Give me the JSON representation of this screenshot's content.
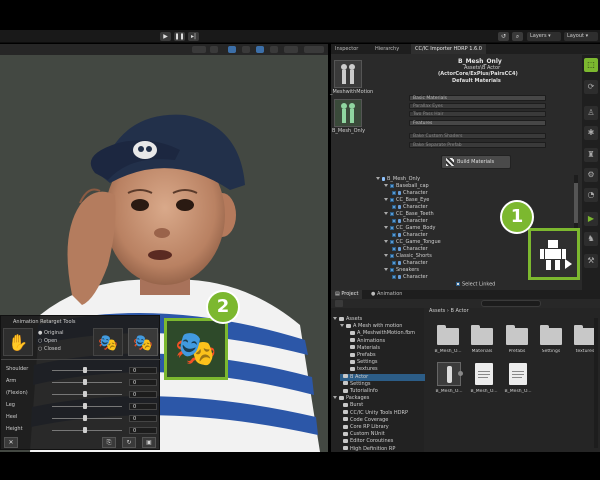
{
  "toolbar": {
    "play_icon": "play-icon",
    "pause_icon": "pause-icon",
    "step_icon": "step-icon",
    "layers_label": "Layers",
    "layout_label": "Layout"
  },
  "inspector": {
    "tabs": [
      "Inspector",
      "Hierarchy",
      "CC/IC Importer HDRP 1.6.0"
    ],
    "thumb1_label": "_MeshwithMotion",
    "thumb2_label": "B_Mesh_Only",
    "header_name": "B_Mesh_Only",
    "header_path": "Assets\\B Actor",
    "header_source": "(ActorCore/ExPlus/PairsCC4)",
    "header_materials": "Default Materials",
    "fields": [
      "Basic Materials",
      "Parallax Eyes",
      "Two Pass Hair",
      "Features"
    ],
    "fields_dim": [
      "Bake Custom Shaders",
      "Bake Separate Prefab"
    ],
    "build_button": "Build Materials",
    "tree": [
      {
        "label": "B_Mesh_Only",
        "indent": 0,
        "kind": "root"
      },
      {
        "label": "Baseball_cap",
        "indent": 1,
        "kind": "node"
      },
      {
        "label": "Character",
        "indent": 2,
        "kind": "leaf"
      },
      {
        "label": "CC_Base_Eye",
        "indent": 1,
        "kind": "node"
      },
      {
        "label": "Character",
        "indent": 2,
        "kind": "leaf"
      },
      {
        "label": "CC_Base_Teeth",
        "indent": 1,
        "kind": "node"
      },
      {
        "label": "Character",
        "indent": 2,
        "kind": "leaf"
      },
      {
        "label": "CC_Game_Body",
        "indent": 1,
        "kind": "node"
      },
      {
        "label": "Character",
        "indent": 2,
        "kind": "leaf"
      },
      {
        "label": "CC_Game_Tongue",
        "indent": 1,
        "kind": "node"
      },
      {
        "label": "Character",
        "indent": 2,
        "kind": "leaf"
      },
      {
        "label": "Classic_Shorts",
        "indent": 1,
        "kind": "node"
      },
      {
        "label": "Character",
        "indent": 2,
        "kind": "leaf"
      },
      {
        "label": "Sneakers",
        "indent": 1,
        "kind": "node"
      },
      {
        "label": "Character",
        "indent": 2,
        "kind": "leaf"
      }
    ],
    "select_linked": "Select Linked"
  },
  "callouts": {
    "one": "1",
    "two": "2"
  },
  "project": {
    "tabs": [
      "Project",
      "Animation"
    ],
    "breadcrumb_root": "Assets",
    "breadcrumb_leaf": "B Actor",
    "tree": [
      {
        "label": "Assets",
        "indent": 0,
        "kind": "open"
      },
      {
        "label": "A Mesh with motion",
        "indent": 1,
        "kind": "open"
      },
      {
        "label": "A_MeshwithMotion.fbm",
        "indent": 2,
        "kind": "folder"
      },
      {
        "label": "Animations",
        "indent": 2,
        "kind": "folder"
      },
      {
        "label": "Materials",
        "indent": 2,
        "kind": "folder"
      },
      {
        "label": "Prefabs",
        "indent": 2,
        "kind": "folder"
      },
      {
        "label": "Settings",
        "indent": 2,
        "kind": "folder"
      },
      {
        "label": "textures",
        "indent": 2,
        "kind": "folder"
      },
      {
        "label": "B Actor",
        "indent": 1,
        "kind": "selected"
      },
      {
        "label": "Settings",
        "indent": 1,
        "kind": "folder"
      },
      {
        "label": "TutorialInfo",
        "indent": 1,
        "kind": "folder"
      },
      {
        "label": "Packages",
        "indent": 0,
        "kind": "open"
      },
      {
        "label": "Burst",
        "indent": 1,
        "kind": "folder"
      },
      {
        "label": "CC/IC Unity Tools HDRP",
        "indent": 1,
        "kind": "folder"
      },
      {
        "label": "Code Coverage",
        "indent": 1,
        "kind": "folder"
      },
      {
        "label": "Core RP Library",
        "indent": 1,
        "kind": "folder"
      },
      {
        "label": "Custom NUnit",
        "indent": 1,
        "kind": "folder"
      },
      {
        "label": "Editor Coroutines",
        "indent": 1,
        "kind": "folder"
      },
      {
        "label": "High Definition RP",
        "indent": 1,
        "kind": "folder"
      }
    ],
    "folders": [
      "B_Mesh_O...",
      "Materials",
      "Prefabs",
      "Settings",
      "textures"
    ],
    "files": [
      "B_Mesh_O...",
      "B_Mesh_O...",
      "B_Mesh_O..."
    ]
  },
  "retarget": {
    "title": "Animation Retarget Tools",
    "radio": [
      "Original",
      "Open",
      "Closed"
    ],
    "sliders": [
      {
        "label": "Shoulder",
        "value": "0"
      },
      {
        "label": "Arm",
        "value": "0"
      },
      {
        "label": "(Flexion)",
        "value": "0"
      },
      {
        "label": "Leg",
        "value": "0"
      },
      {
        "label": "Heel",
        "value": "0"
      },
      {
        "label": "Height",
        "value": "0"
      }
    ],
    "close_label": "✕"
  }
}
